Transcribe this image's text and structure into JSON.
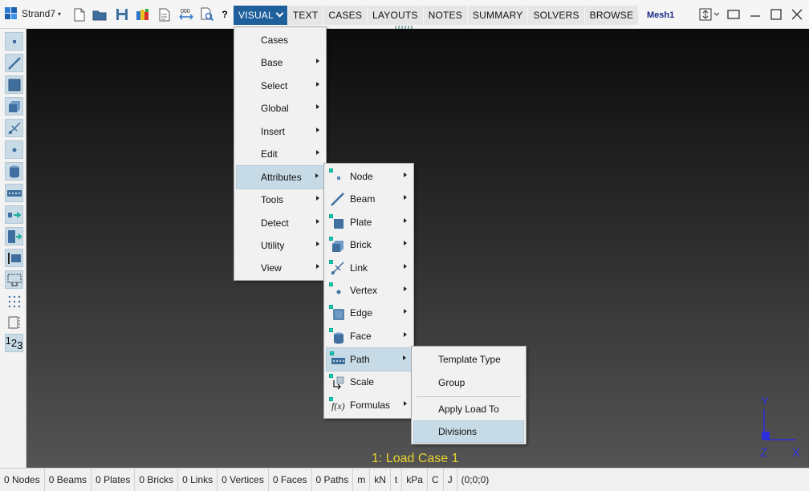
{
  "app": {
    "name": "Strand7",
    "model_name": "Mesh1"
  },
  "menubar": {
    "items": [
      {
        "label": "VISUAL",
        "active": true
      },
      {
        "label": "TEXT"
      },
      {
        "label": "CASES"
      },
      {
        "label": "LAYOUTS"
      },
      {
        "label": "NOTES"
      },
      {
        "label": "SUMMARY"
      },
      {
        "label": "SOLVERS"
      },
      {
        "label": "BROWSE"
      }
    ]
  },
  "quick_toolbar": {
    "help_label": "?",
    "icons": [
      "new-file-icon",
      "open-folder-icon",
      "save-icon",
      "color-scheme-icon",
      "document-icon",
      "renumber-icon",
      "zoom-document-icon",
      "help-icon"
    ]
  },
  "left_toolbar": {
    "icons": [
      "node-tool-icon",
      "beam-tool-icon",
      "plate-tool-icon",
      "brick-tool-icon",
      "link-tool-icon",
      "vertex-tool-icon",
      "face-tool-icon",
      "path-tool-icon",
      "arrow-load-icon",
      "freedom-case-icon",
      "plate-edge-icon",
      "select-window-icon",
      "grid-dots-icon",
      "split-icon",
      "numbering-icon"
    ],
    "numbering_label": "123"
  },
  "visual_menu": {
    "items": [
      {
        "label": "Cases",
        "submenu": false
      },
      {
        "label": "Base",
        "submenu": true
      },
      {
        "label": "Select",
        "submenu": true
      },
      {
        "label": "Global",
        "submenu": true
      },
      {
        "label": "Insert",
        "submenu": true
      },
      {
        "label": "Edit",
        "submenu": true
      },
      {
        "label": "Attributes",
        "submenu": true,
        "highlighted": true
      },
      {
        "label": "Tools",
        "submenu": true
      },
      {
        "label": "Detect",
        "submenu": true
      },
      {
        "label": "Utility",
        "submenu": true
      },
      {
        "label": "View",
        "submenu": true
      }
    ]
  },
  "attributes_menu": {
    "items": [
      {
        "label": "Node",
        "icon": "node-icon",
        "submenu": true
      },
      {
        "label": "Beam",
        "icon": "beam-icon",
        "submenu": true
      },
      {
        "label": "Plate",
        "icon": "plate-icon",
        "submenu": true
      },
      {
        "label": "Brick",
        "icon": "brick-icon",
        "submenu": true
      },
      {
        "label": "Link",
        "icon": "link-icon",
        "submenu": true
      },
      {
        "label": "Vertex",
        "icon": "vertex-icon",
        "submenu": true
      },
      {
        "label": "Edge",
        "icon": "edge-icon",
        "submenu": true
      },
      {
        "label": "Face",
        "icon": "face-icon",
        "submenu": true
      },
      {
        "label": "Path",
        "icon": "path-icon",
        "submenu": true,
        "highlighted": true
      },
      {
        "label": "Scale",
        "icon": "scale-icon",
        "submenu": false
      },
      {
        "label": "Formulas",
        "icon": "formula-icon",
        "submenu": true
      }
    ]
  },
  "path_menu": {
    "items": [
      {
        "label": "Template Type"
      },
      {
        "label": "Group"
      },
      {
        "label": "Apply Load To"
      },
      {
        "label": "Divisions",
        "highlighted": true
      }
    ]
  },
  "viewport": {
    "load_case": "1: Load Case 1",
    "axes": {
      "y": "Y",
      "z": "Z",
      "x": "X"
    }
  },
  "statusbar": {
    "cells": [
      "0 Nodes",
      "0 Beams",
      "0 Plates",
      "0 Bricks",
      "0 Links",
      "0 Vertices",
      "0 Faces",
      "0 Paths",
      "m",
      "kN",
      "t",
      "kPa",
      "C",
      "J",
      "(0;0;0)"
    ]
  },
  "colors": {
    "menu_active": "#1e5f9c",
    "highlight": "#c6dbe6",
    "load_case_text": "#e8d230",
    "axis_color": "#2d2de0"
  }
}
